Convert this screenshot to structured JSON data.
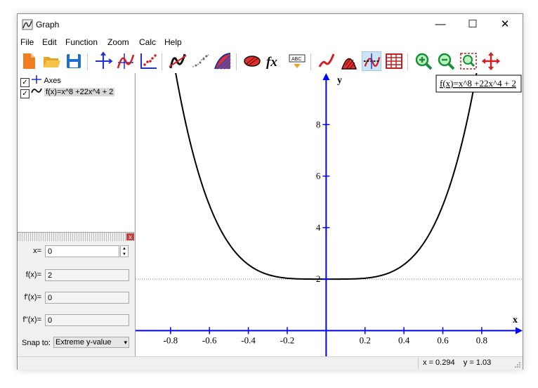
{
  "window": {
    "title": "Graph",
    "minimize_glyph": "—",
    "maximize_glyph": "☐",
    "close_glyph": "✕"
  },
  "menu": [
    "File",
    "Edit",
    "Function",
    "Zoom",
    "Calc",
    "Help"
  ],
  "toolbar": [
    {
      "name": "new-icon"
    },
    {
      "name": "open-icon"
    },
    {
      "name": "save-icon"
    },
    {
      "name": "axes-icon"
    },
    {
      "name": "insert-function-icon"
    },
    {
      "name": "point-series-icon"
    },
    {
      "name": "tangent-icon"
    },
    {
      "name": "trendline-icon"
    },
    {
      "name": "shading-icon"
    },
    {
      "name": "relation-icon"
    },
    {
      "name": "fx-icon"
    },
    {
      "name": "label-icon"
    },
    {
      "name": "derivative-icon"
    },
    {
      "name": "area-icon"
    },
    {
      "name": "evaluate-icon",
      "active": true
    },
    {
      "name": "table-icon"
    },
    {
      "name": "zoom-in-icon"
    },
    {
      "name": "zoom-out-icon"
    },
    {
      "name": "zoom-window-icon"
    },
    {
      "name": "move-icon"
    }
  ],
  "tree": {
    "axes_label": "Axes",
    "function_label": "f(x)=x^8 +22x^4 + 2",
    "check_glyph": "✓"
  },
  "eval_panel": {
    "close_glyph": "x",
    "x_label": "x=",
    "x_value": "0",
    "fx_label": "f(x)=",
    "fx_value": "2",
    "f1_label": "f'(x)=",
    "f1_value": "0",
    "f2_label": "f''(x)=",
    "f2_value": "0",
    "snap_label": "Snap to:",
    "snap_value": "Extreme y-value"
  },
  "graph": {
    "legend": "f(x)=x^8 +22x^4 + 2",
    "x_axis_label": "x",
    "y_axis_label": "y",
    "x_ticks": [
      "-0.8",
      "-0.6",
      "-0.4",
      "-0.2",
      "0.2",
      "0.4",
      "0.6",
      "0.8"
    ],
    "y_ticks": [
      "2",
      "4",
      "6",
      "8"
    ],
    "curve_color": "#000000",
    "axis_color": "#0000ff"
  },
  "chart_data": {
    "type": "line",
    "series": [
      {
        "name": "f(x)=x^8 +22x^4 + 2",
        "expression": "x^8 +22x^4 + 2"
      }
    ],
    "xlim": [
      -0.98,
      1.01
    ],
    "ylim": [
      -1,
      10
    ],
    "x_ticks": [
      -0.8,
      -0.6,
      -0.4,
      -0.2,
      0.2,
      0.4,
      0.6,
      0.8
    ],
    "y_ticks": [
      2,
      4,
      6,
      8
    ],
    "xlabel": "x",
    "ylabel": "y",
    "evaluation_line_y": 2,
    "legend_position": "top-right"
  },
  "status": {
    "coords": "x = 0.294    y = 1.03"
  }
}
